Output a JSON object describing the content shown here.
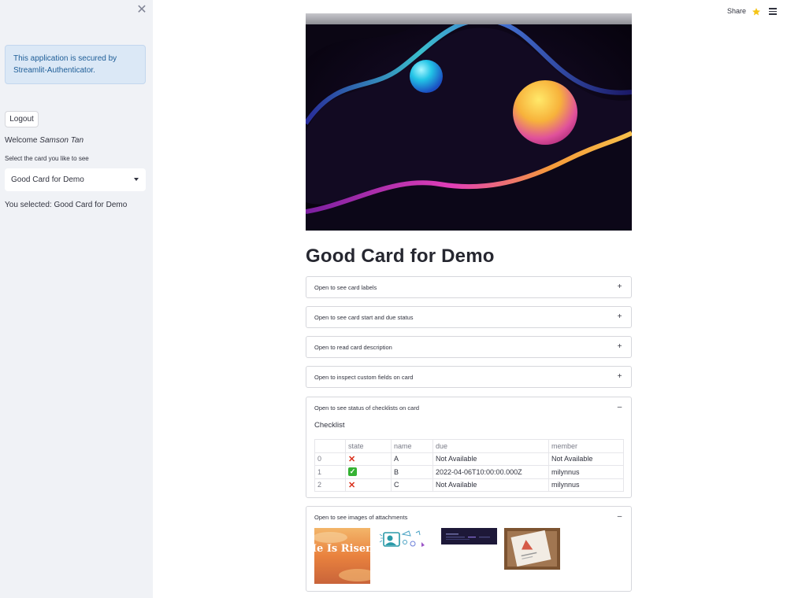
{
  "sidebar": {
    "info_text": "This application is secured by Streamlit-Authenticator.",
    "logout_label": "Logout",
    "welcome_prefix": "Welcome",
    "user_name": "Samson Tan",
    "select_label": "Select the card you like to see",
    "selected_card": "Good Card for Demo",
    "selected_text": "You selected: Good Card for Demo"
  },
  "header": {
    "share_label": "Share"
  },
  "main": {
    "title": "Good Card for Demo",
    "expanders": [
      {
        "label": "Open to see card labels",
        "expanded": false
      },
      {
        "label": "Open to see card start and due status",
        "expanded": false
      },
      {
        "label": "Open to read card description",
        "expanded": false
      },
      {
        "label": "Open to inspect custom fields on card",
        "expanded": false
      },
      {
        "label": "Open to see status of checklists on card",
        "expanded": true
      },
      {
        "label": "Open to see images of attachments",
        "expanded": true
      }
    ],
    "checklist": {
      "label": "Checklist",
      "columns": [
        "",
        "state",
        "name",
        "due",
        "member"
      ],
      "rows": [
        {
          "index": "0",
          "state": "cross",
          "name": "A",
          "due": "Not Available",
          "member": "Not Available"
        },
        {
          "index": "1",
          "state": "check",
          "name": "B",
          "due": "2022-04-06T10:00:00.000Z",
          "member": "milynnus"
        },
        {
          "index": "2",
          "state": "cross",
          "name": "C",
          "due": "Not Available",
          "member": "milynnus"
        }
      ]
    },
    "attachments": {
      "first_image_text": "He Is Risen!"
    }
  },
  "colors": {
    "accent": "#f5c518",
    "info_bg": "#dbe8f6",
    "sidebar_bg": "#f0f2f6"
  }
}
